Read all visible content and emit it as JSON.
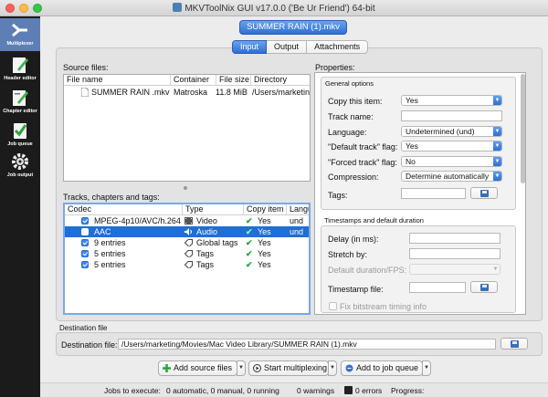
{
  "window": {
    "title": "MKVToolNix GUI v17.0.0 ('Be Ur Friend') 64-bit"
  },
  "sidebar": {
    "items": [
      {
        "label": "Multiplexer"
      },
      {
        "label": "Header editor"
      },
      {
        "label": "Chapter editor"
      },
      {
        "label": "Job queue"
      },
      {
        "label": "Job output"
      }
    ]
  },
  "file_button": "SUMMER RAIN  (1).mkv",
  "tabs": [
    {
      "label": "Input"
    },
    {
      "label": "Output"
    },
    {
      "label": "Attachments"
    }
  ],
  "source_files": {
    "label": "Source files:",
    "columns": [
      "File name",
      "Container",
      "File size",
      "Directory"
    ],
    "rows": [
      {
        "name": "SUMMER RAIN .mkv",
        "container": "Matroska",
        "size": "11.8 MiB",
        "directory": "/Users/marketing"
      }
    ]
  },
  "tracks": {
    "label": "Tracks, chapters and tags:",
    "columns": [
      "Codec",
      "Type",
      "Copy item",
      "Langu"
    ],
    "rows": [
      {
        "codec": "MPEG-4p10/AVC/h.264",
        "type": "Video",
        "copy": "Yes",
        "lang": "und",
        "selected": false
      },
      {
        "codec": "AAC",
        "type": "Audio",
        "copy": "Yes",
        "lang": "und",
        "selected": true
      },
      {
        "codec": "9 entries",
        "type": "Global tags",
        "copy": "Yes",
        "lang": "",
        "selected": false
      },
      {
        "codec": "5 entries",
        "type": "Tags",
        "copy": "Yes",
        "lang": "",
        "selected": false
      },
      {
        "codec": "5 entries",
        "type": "Tags",
        "copy": "Yes",
        "lang": "",
        "selected": false
      }
    ]
  },
  "properties": {
    "label": "Properties:",
    "general_title": "General options",
    "copy_label": "Copy this item:",
    "copy_value": "Yes",
    "track_name_label": "Track name:",
    "language_label": "Language:",
    "language_value": "Undetermined (und)",
    "default_label": "\"Default track\" flag:",
    "default_value": "Yes",
    "forced_label": "\"Forced track\" flag:",
    "forced_value": "No",
    "compression_label": "Compression:",
    "compression_value": "Determine automatically",
    "tags_label": "Tags:",
    "timestamps_title": "Timestamps and default duration",
    "delay_label": "Delay (in ms):",
    "stretch_label": "Stretch by:",
    "duration_label": "Default duration/FPS:",
    "timestamp_file_label": "Timestamp file:",
    "fix_label": "Fix bitstream timing info"
  },
  "destination": {
    "section": "Destination file",
    "label": "Destination file:",
    "value": "/Users/marketing/Movies/Mac Video Library/SUMMER RAIN  (1).mkv"
  },
  "actions": {
    "add": "Add source files",
    "start": "Start multiplexing",
    "queue": "Add to job queue"
  },
  "status": {
    "jobs_label": "Jobs to execute:",
    "jobs_value": "0 automatic, 0 manual, 0 running",
    "warnings": "0 warnings",
    "errors": "0 errors",
    "progress_label": "Progress:"
  },
  "colors": {
    "accent": "#2f6fd6",
    "selection": "#1f6fd4",
    "sidebar": "#1b1b1b",
    "check": "#2aa33a"
  }
}
